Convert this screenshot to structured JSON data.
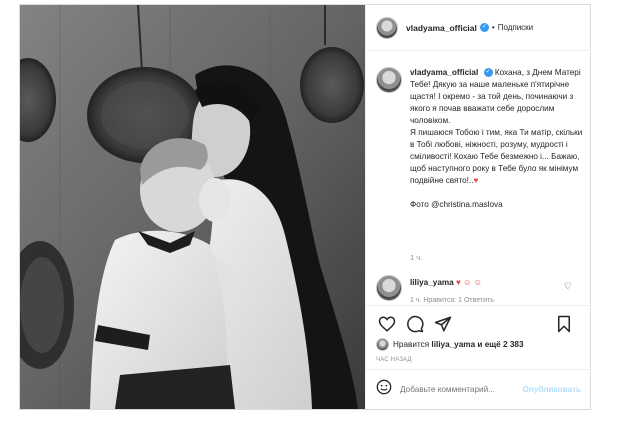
{
  "post": {
    "username": "vladyama_official",
    "header_separator": "•",
    "follow_label": "Подписки",
    "caption": {
      "username": "vladyama_official",
      "text_p1": "Кохана, з Днем Матері Тебе! Дякую за наше маленьке п'ятирічне щастя! І окремо - за той день, починаючи з якого я почав вважати себе дорослим чоловіком.",
      "text_p2": "Я пишаюся Тобою і тим, яка Ти матір, скільки в Тобі любові, ніжності, розуму, мудрості і сміливості! Кохаю Тебе безмежно і... Бажаю, щоб наступного року в Тебе було як мінімум подвійне свято!..",
      "heart": "♥",
      "photo_credit": "Фото @christina.maslova",
      "time": "1 ч."
    },
    "comment": {
      "username": "liliya_yama",
      "emojis": "♥ ☺ ☺",
      "meta": "1 ч.   Нравится: 1   Ответить"
    },
    "likes": {
      "prefix": "Нравится",
      "user": "liliya_yama",
      "suffix": "и ещё 2 383"
    },
    "time_ago": "ЧАС НАЗАД",
    "add_comment": {
      "placeholder": "Добавьте комментарий...",
      "publish_label": "Опубликовать"
    }
  },
  "icons": [
    "verified-badge-icon",
    "heart-icon",
    "comment-icon",
    "share-icon",
    "bookmark-icon",
    "emoji-icon",
    "heart-outline-icon"
  ],
  "colors": {
    "accent": "#3897f0",
    "like": "#ed4956",
    "muted": "#8e8e8e",
    "publish_disabled": "#b2dffc"
  }
}
